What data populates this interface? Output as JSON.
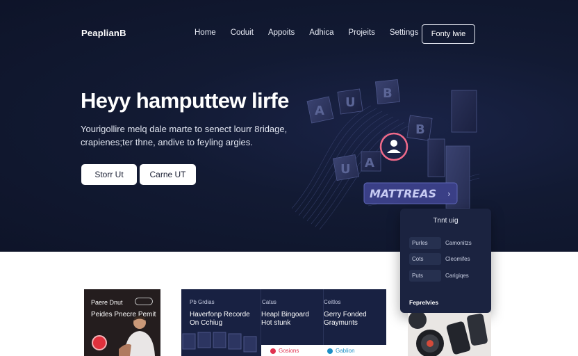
{
  "header": {
    "logo": "PeaplianB",
    "nav": [
      "Home",
      "Coduit",
      "Appoits",
      "Adhica",
      "Projeits",
      "Settings"
    ],
    "cta": "Fonty lwie"
  },
  "hero": {
    "headline": "Heyy hamputtew lirfe",
    "subline": "Yourigollire melq dale marte to senect lourr 8ridage, crapienes;ter thne, andive to feyling argies.",
    "button_primary": "Storr Ut",
    "button_secondary": "Carne UT",
    "badge": "MATTREAS",
    "letters": [
      "A",
      "U",
      "B",
      "U",
      "A",
      "B"
    ]
  },
  "panel": {
    "title": "Tnnt uig",
    "rows": [
      {
        "chip": "Purles",
        "value": "Camonitzs"
      },
      {
        "chip": "Cots",
        "value": "Cleomifes"
      },
      {
        "chip": "Puts",
        "value": "Carigiqes"
      }
    ],
    "footer": "Feprelvies"
  },
  "cards": {
    "card1": {
      "label": "Paere Dnut",
      "heading": "Peides Pnecre Pemit"
    },
    "card2": {
      "cols": [
        {
          "label": "Pb Grdias",
          "text": "Haverfonp Recorde On Cchiug"
        },
        {
          "label": "Catus",
          "text": "Heapl Bingoard Hot stunk"
        },
        {
          "label": "Ceitlos",
          "text": "Gerry Fonded Graymunts"
        }
      ],
      "items": [
        {
          "label": "Gosions",
          "color": "#e0314f"
        },
        {
          "label": "Gablion",
          "color": "#1c8ec5"
        }
      ]
    }
  }
}
